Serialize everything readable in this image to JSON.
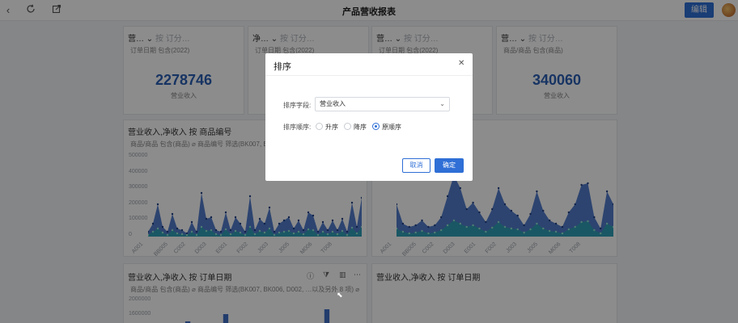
{
  "topbar": {
    "back_icon": "chevron-left-icon",
    "refresh_icon": "refresh-icon",
    "share_icon": "external-link-icon",
    "title": "产品营收报表",
    "edit_label": "编辑"
  },
  "cards": {
    "kpi1": {
      "title": "营…",
      "title_extra": "按 订分…",
      "filter": "订单日期 包含(2022)",
      "value": "2278746",
      "label": "营业收入"
    },
    "kpi2": {
      "title": "净…",
      "title_extra": "按 订分…",
      "filter": "订单日期 包含(2022)"
    },
    "kpi3": {
      "title": "营…",
      "title_extra": "按 订分…",
      "filter": "订单日期 包含(2022)"
    },
    "kpi4": {
      "title": "营…",
      "title_extra": "按 订分…",
      "filter": "商品/商品 包含(商品)",
      "value": "340060",
      "label": "营业收入"
    },
    "chart1": {
      "title": "营业收入,净收入 按 商品编号",
      "filter": "商品/商品 包含(商品) ⌀  商品编号 筛选(BK007, BK0…"
    },
    "chart2": {
      "title": "营业收入,净收入 按 订单日期",
      "filter": "商品/商品 包含(商品) ⌀  商品编号 筛选(BK007, BK006, D002, …以及另外 8 项) ⌀"
    },
    "chart3": {
      "title": "营业收入,净收入 按 订单日期"
    },
    "chart4": {
      "title": "营业收入,净收入 按 订单日期"
    }
  },
  "chart_data": [
    {
      "type": "area",
      "title": "营业收入,净收入 按 商品编号",
      "y_ticks": [
        "500000",
        "400000",
        "300000",
        "200000",
        "100000",
        "0"
      ],
      "x_ticks": [
        "A001",
        "BB005",
        "C002",
        "D003",
        "E001",
        "F002",
        "J003",
        "J005",
        "M006",
        "T008"
      ],
      "ylim": [
        0,
        500000
      ],
      "series": [
        {
          "values": [
            30000,
            80000,
            200000,
            60000,
            30000,
            140000,
            50000,
            40000,
            20000,
            90000,
            30000,
            270000,
            110000,
            120000,
            40000,
            30000,
            150000,
            40000,
            120000,
            80000,
            30000,
            250000,
            40000,
            110000,
            80000,
            180000,
            30000,
            80000,
            100000,
            120000,
            50000,
            100000,
            40000,
            150000,
            130000,
            30000,
            90000,
            40000,
            100000,
            40000,
            110000,
            30000,
            210000,
            60000,
            240000
          ]
        },
        {
          "values": [
            10000,
            30000,
            50000,
            25000,
            10000,
            40000,
            20000,
            15000,
            10000,
            30000,
            10000,
            60000,
            35000,
            40000,
            15000,
            10000,
            45000,
            15000,
            35000,
            25000,
            10000,
            60000,
            15000,
            35000,
            25000,
            50000,
            10000,
            25000,
            30000,
            35000,
            20000,
            30000,
            15000,
            45000,
            40000,
            10000,
            30000,
            15000,
            30000,
            15000,
            35000,
            10000,
            55000,
            20000,
            60000
          ]
        }
      ]
    },
    {
      "type": "area",
      "title": "营业收入,净收入 按 订单日期",
      "x_ticks": [
        "A001",
        "BB005",
        "C002",
        "D003",
        "E001",
        "F002",
        "J003",
        "J005",
        "M006",
        "T008"
      ],
      "ylim": [
        0,
        500000
      ],
      "series": [
        {
          "values": [
            200000,
            80000,
            60000,
            70000,
            100000,
            60000,
            70000,
            120000,
            250000,
            380000,
            300000,
            170000,
            210000,
            150000,
            90000,
            170000,
            300000,
            200000,
            160000,
            130000,
            70000,
            140000,
            280000,
            160000,
            100000,
            80000,
            60000,
            150000,
            200000,
            320000,
            330000,
            120000,
            50000,
            280000,
            200000
          ]
        },
        {
          "values": [
            50000,
            30000,
            20000,
            25000,
            35000,
            20000,
            25000,
            40000,
            70000,
            100000,
            80000,
            60000,
            70000,
            50000,
            30000,
            55000,
            90000,
            60000,
            50000,
            45000,
            25000,
            45000,
            80000,
            50000,
            35000,
            30000,
            20000,
            45000,
            60000,
            90000,
            95000,
            40000,
            20000,
            80000,
            60000
          ]
        }
      ]
    },
    {
      "type": "bar",
      "title": "营业收入,净收入 按 订单日期",
      "y_ticks": [
        "2000000",
        "1600000"
      ],
      "ylim": [
        0,
        2000000
      ],
      "values": [
        0,
        0,
        150000,
        0,
        0,
        300000,
        0,
        0,
        0,
        0,
        0,
        0,
        0,
        400000,
        0,
        0
      ]
    }
  ],
  "modal": {
    "title": "排序",
    "close_icon": "close-icon",
    "field_label": "排序字段:",
    "field_value": "营业收入",
    "order_label": "排序顺序:",
    "options": [
      "升序",
      "降序",
      "原顺序"
    ],
    "selected": "原顺序",
    "cancel": "取消",
    "ok": "确定"
  }
}
